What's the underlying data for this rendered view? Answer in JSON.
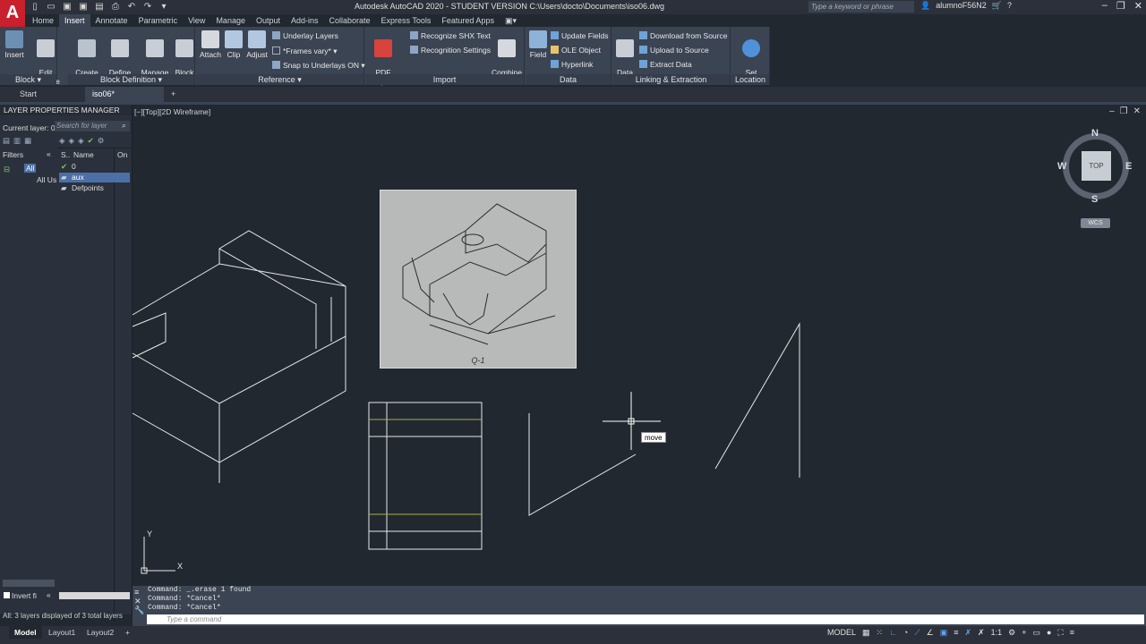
{
  "title_bar": {
    "app_letter": "A",
    "title": "Autodesk AutoCAD 2020 - STUDENT VERSION    C:\\Users\\docto\\Documents\\iso06.dwg",
    "search_placeholder": "Type a keyword or phrase",
    "user": "alumnoF56N2"
  },
  "ribbon_tabs": [
    "Home",
    "Insert",
    "Annotate",
    "Parametric",
    "View",
    "Manage",
    "Output",
    "Add-ins",
    "Collaborate",
    "Express Tools",
    "Featured Apps"
  ],
  "active_tab": "Insert",
  "panels": {
    "block": {
      "title": "Block",
      "insert": "Insert",
      "edit_attribute": "Edit\nAttribute"
    },
    "block_definition": {
      "title": "Block Definition",
      "create_block": "Create\nBlock",
      "define_attributes": "Define\nAttributes",
      "manage_attributes": "Manage\nAttributes",
      "block_editor": "Block\nEditor"
    },
    "reference": {
      "title": "Reference",
      "attach": "Attach",
      "clip": "Clip",
      "adjust": "Adjust",
      "underlay_layers": "Underlay Layers",
      "frames_vary": "*Frames vary*",
      "snap_underlays": "Snap to Underlays ON"
    },
    "import": {
      "title": "Import",
      "pdf_import": "PDF\nImport",
      "recognize_shx": "Recognize SHX Text",
      "recognition_settings": "Recognition Settings",
      "combine_text": "Combine\nText"
    },
    "data": {
      "title": "Data",
      "field": "Field",
      "update_fields": "Update Fields",
      "ole_object": "OLE Object",
      "hyperlink": "Hyperlink"
    },
    "linking": {
      "title": "Linking & Extraction",
      "data_link": "Data\nLink",
      "download_source": "Download from Source",
      "upload_source": "Upload to Source",
      "extract_data": "Extract  Data"
    },
    "location": {
      "title": "Location",
      "set_location": "Set\nLocation"
    }
  },
  "doc_tabs": [
    "Start",
    "iso06*"
  ],
  "layer_panel": {
    "title": "LAYER PROPERTIES MANAGER",
    "current_layer": "Current layer: 0",
    "search_placeholder": "Search for layer",
    "filters_label": "Filters",
    "tree_all": "All",
    "tree_all_used": "All Us",
    "col_status": "S..",
    "col_name": "Name",
    "col_on": "On",
    "layers": [
      "0",
      "aux",
      "Defpoints"
    ],
    "invert_filter": "Invert fi",
    "footer": "All: 3 layers displayed of 3 total layers"
  },
  "viewport": {
    "label": "[−][Top][2D Wireframe]",
    "compass": {
      "n": "N",
      "s": "S",
      "e": "E",
      "w": "W",
      "top": "TOP"
    },
    "wcs": "WCS",
    "image_caption": "Q-1",
    "cursor_tooltip": "move",
    "ucs_x": "X",
    "ucs_y": "Y"
  },
  "command_line": {
    "history": [
      "Command: _.erase 1 found",
      "Command: *Cancel*",
      "Command: *Cancel*"
    ],
    "placeholder": "Type a command"
  },
  "status_bar": {
    "tabs": [
      "Model",
      "Layout1",
      "Layout2"
    ],
    "mode": "MODEL",
    "scale": "1:1"
  },
  "colors": {
    "background": "#212830",
    "ribbon": "#3b4453",
    "app_red": "#c8202c",
    "accent_blue": "#62a7f0"
  }
}
